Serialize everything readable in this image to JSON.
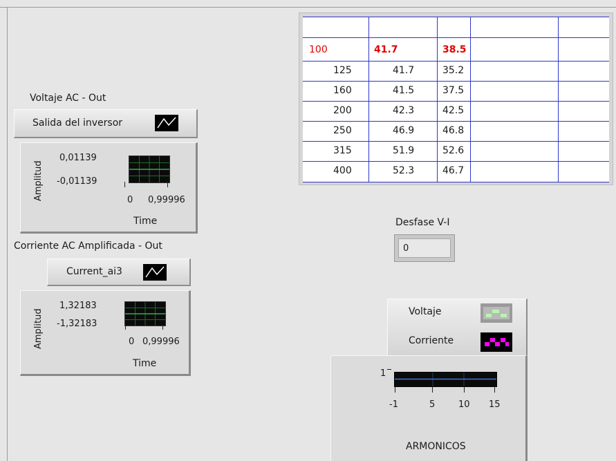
{
  "voltage_section": {
    "title": "Voltaje AC - Out",
    "selector_label": "Salida del inversor",
    "graph": {
      "y_label": "Amplitud",
      "y_max": "0,01139",
      "y_min": "-0,01139",
      "x_min": "0",
      "x_max": "0,99996",
      "x_label": "Time"
    }
  },
  "current_section": {
    "title": "Corriente AC Amplificada - Out",
    "selector_label": "Current_ai3",
    "graph": {
      "y_label": "Amplitud",
      "y_max": "1,32183",
      "y_min": "-1,32183",
      "x_min": "0",
      "x_max": "0,99996",
      "x_label": "Time"
    }
  },
  "table": {
    "rows": [
      [
        "",
        "",
        "",
        "",
        ""
      ],
      [
        "100",
        "41.7",
        "38.5",
        "",
        ""
      ],
      [
        "125",
        "41.7",
        "35.2",
        "",
        ""
      ],
      [
        "160",
        "41.5",
        "37.5",
        "",
        ""
      ],
      [
        "200",
        "42.3",
        "42.5",
        "",
        ""
      ],
      [
        "250",
        "46.9",
        "46.8",
        "",
        ""
      ],
      [
        "315",
        "51.9",
        "52.6",
        "",
        ""
      ],
      [
        "400",
        "52.3",
        "46.7",
        "",
        ""
      ]
    ],
    "highlight_color": "#e00000",
    "grid_color": "#2f35c9"
  },
  "desfase": {
    "label": "Desfase V-I",
    "value": "0"
  },
  "armonicos": {
    "legend": [
      {
        "name": "Voltaje",
        "color": "#b9f5b0"
      },
      {
        "name": "Corriente",
        "color": "#ff00ff"
      }
    ],
    "y_tick": "1",
    "x_ticks": [
      "-1",
      "5",
      "10",
      "15"
    ],
    "title": "ARMONICOS"
  }
}
